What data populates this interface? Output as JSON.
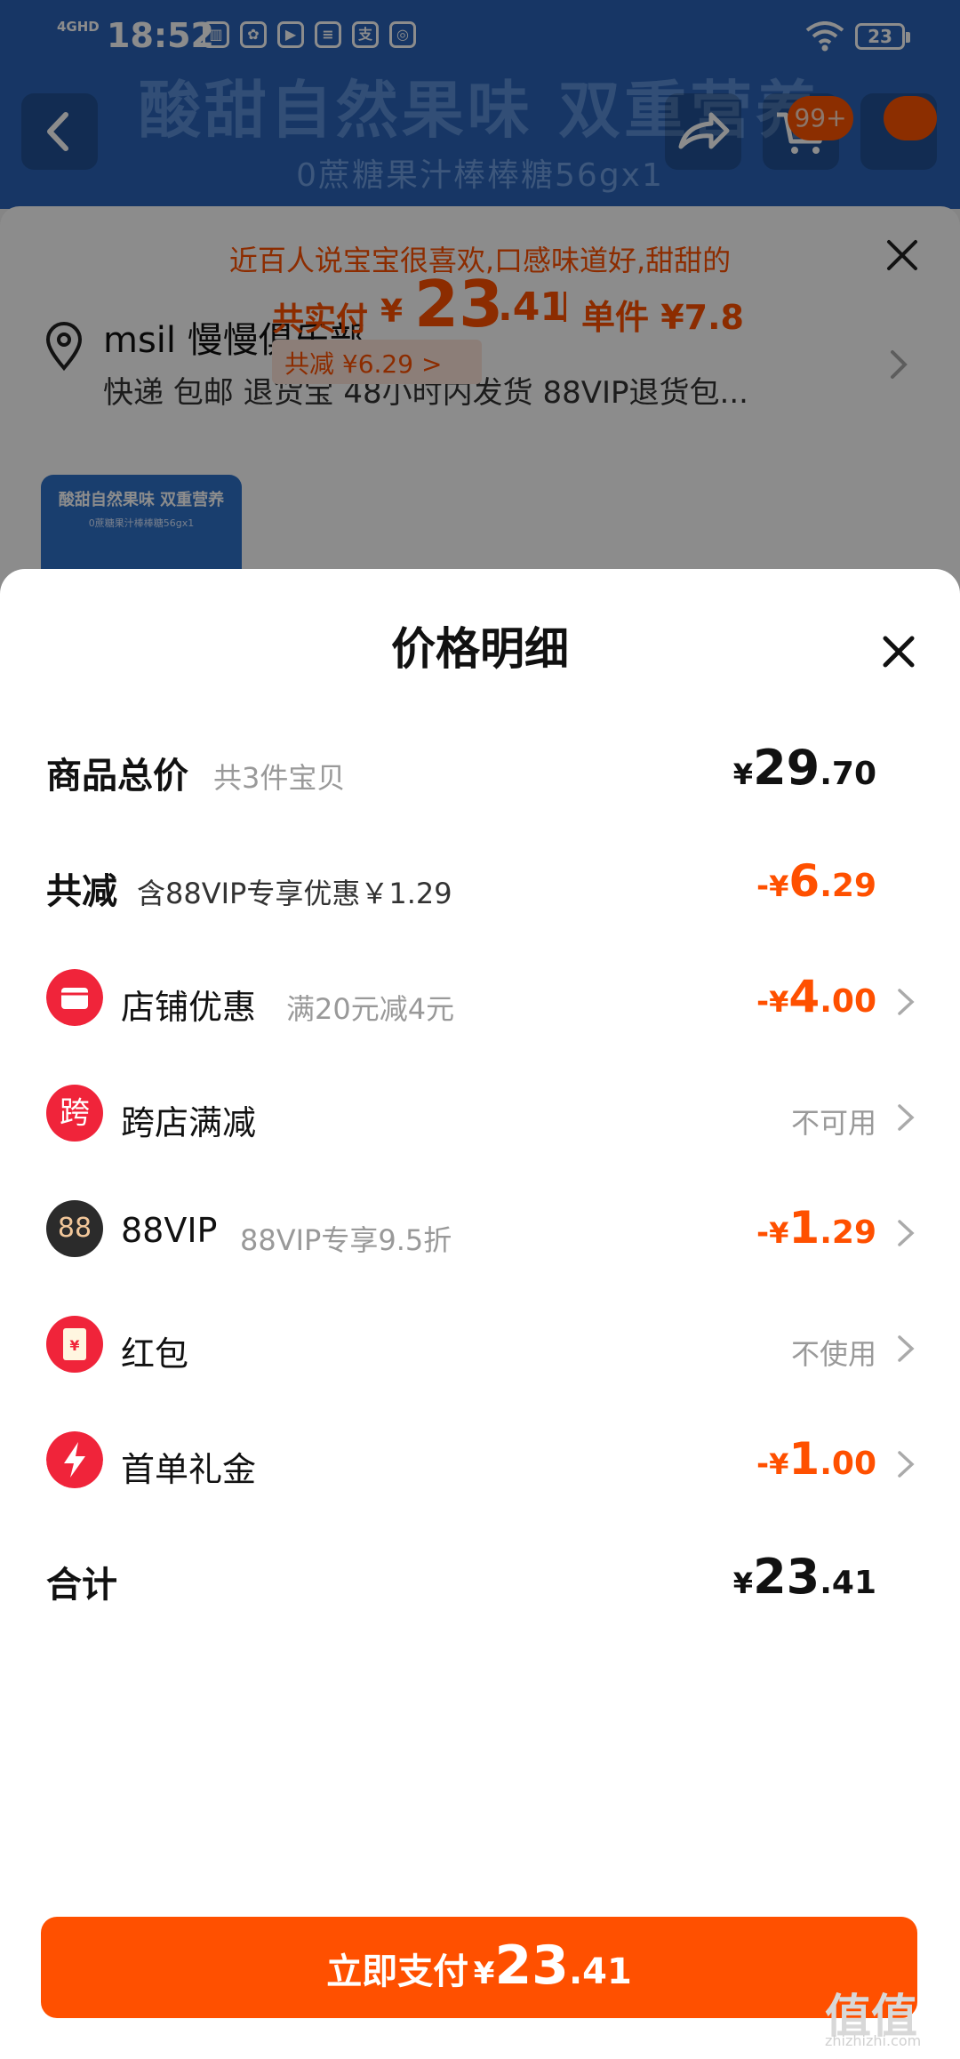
{
  "status_bar": {
    "network": "4GHD",
    "time": "18:52",
    "app_icons": [
      "book-icon",
      "baidu-icon",
      "video-icon",
      "list-icon",
      "alipay-icon",
      "note-icon"
    ],
    "battery": "23"
  },
  "background_page": {
    "banner_title": "酸甜自然果味  双重营养",
    "banner_subtitle": "0蔗糖果汁棒棒糖56gx1",
    "cart_badge": "99+",
    "promo_tip": "近百人说宝宝很喜欢,口感味道好,甜甜的",
    "address_name": "msil 慢慢俱乐部",
    "delivery_info": "快递 包邮 退货宝 48小时内发货 88VIP退货包...",
    "thumb_title": "酸甜自然果味  双重营养",
    "thumb_subtitle": "0蔗糖果汁棒棒糖56gx1",
    "pay_label": "共实付",
    "pay_currency": "¥",
    "pay_integer": "23",
    "pay_decimal": ".41",
    "unit_price": "单件 ¥7.8",
    "saving_tag": "共减 ¥6.29 >"
  },
  "sheet": {
    "title": "价格明细",
    "rows": [
      {
        "label": "商品总价",
        "sub": "共3件宝贝",
        "currency": "¥",
        "integer": "29",
        "decimal": ".70"
      },
      {
        "label": "共减",
        "sub": "含88VIP专享优惠￥1.29",
        "sign": "-",
        "currency": "¥",
        "integer": "6",
        "decimal": ".29"
      },
      {
        "label": "店铺优惠",
        "sub": "满20元减4元",
        "icon": "shop-icon",
        "sign": "-",
        "currency": "¥",
        "integer": "4",
        "decimal": ".00"
      },
      {
        "label": "跨店满减",
        "icon_text": "跨",
        "icon": "cross-store-icon",
        "status": "不可用"
      },
      {
        "label": "88VIP",
        "sub": "88VIP专享9.5折",
        "icon_text": "88",
        "icon": "vip88-icon",
        "sign": "-",
        "currency": "¥",
        "integer": "1",
        "decimal": ".29"
      },
      {
        "label": "红包",
        "icon": "red-envelope-icon",
        "icon_text": "¥",
        "status": "不使用"
      },
      {
        "label": "首单礼金",
        "icon": "lightning-icon",
        "sign": "-",
        "currency": "¥",
        "integer": "1",
        "decimal": ".00"
      },
      {
        "label": "合计",
        "currency": "¥",
        "integer": "23",
        "decimal": ".41"
      }
    ],
    "pay_button": {
      "label": "立即支付",
      "currency": "¥",
      "integer": "23",
      "decimal": ".41"
    }
  },
  "watermark": {
    "text": "值值值",
    "sub": "zhizhizhi.com"
  },
  "colors": {
    "accent": "#ff5000",
    "vip": "#2b2b2b",
    "red_badge": "#f0243a"
  }
}
